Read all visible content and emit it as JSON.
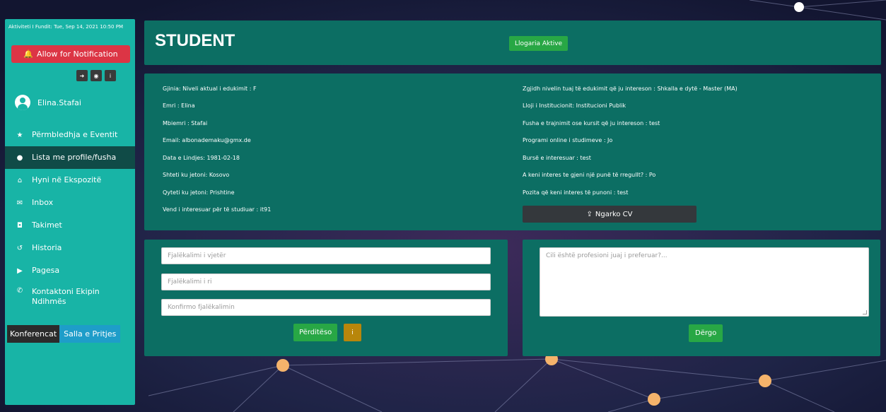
{
  "sidebar": {
    "last_activity": "Aktiviteti I Fundit: Tue, Sep 14, 2021 10:50 PM",
    "notification_label": "Allow for Notification",
    "tools": [
      {
        "icon": "logout-icon",
        "glyph": "➜"
      },
      {
        "icon": "globe-icon",
        "glyph": "◉"
      },
      {
        "icon": "info-icon",
        "glyph": "i"
      }
    ],
    "username": "Elina.Stafai",
    "items": [
      {
        "label": "Përmbledhja e Eventit",
        "icon": "star-icon",
        "glyph": "★",
        "active": false
      },
      {
        "label": "Lista me profile/fusha",
        "icon": "user-icon",
        "glyph": "●",
        "active": true
      },
      {
        "label": "Hyni në Ekspozitë",
        "icon": "bank-icon",
        "glyph": "⌂",
        "active": false
      },
      {
        "label": "Inbox",
        "icon": "envelope-icon",
        "glyph": "✉",
        "active": false
      },
      {
        "label": "Takimet",
        "icon": "camera-icon",
        "glyph": "◘",
        "active": false
      },
      {
        "label": "Historia",
        "icon": "history-icon",
        "glyph": "↺",
        "active": false
      },
      {
        "label": "Pagesa",
        "icon": "payment-icon",
        "glyph": "▶",
        "active": false
      },
      {
        "label": "Kontaktoni Ekipin Ndihmës",
        "icon": "phone-icon",
        "glyph": "✆",
        "active": false
      }
    ],
    "tab_conferences": "Konferencat",
    "tab_waiting_room": "Salla e Pritjes"
  },
  "header": {
    "title": "STUDENT",
    "status": "Llogaria Aktive"
  },
  "profile": {
    "left_fields": [
      "Gjinia: Niveli aktual i edukimit : F",
      "Emri : Elina",
      "Mbiemri : Stafai",
      "Email: albonademaku@gmx.de",
      "Data e Lindjes: 1981-02-18",
      "Shteti ku jetoni: Kosovo",
      "Qyteti ku jetoni: Prishtine",
      "Vend i interesuar për të studiuar : it91"
    ],
    "right_fields": [
      "Zgjidh nivelin tuaj të edukimit që ju intereson : Shkalla e dytë - Master (MA)",
      "Lloji i Institucionit: Institucioni Publik",
      "Fusha e trajnimit ose kursit që ju intereson : test",
      "Programi online i studimeve : Jo",
      "Bursë e interesuar : test",
      "A keni interes te gjeni një punë të rregullt? : Po",
      "Pozita që keni interes të punoni : test"
    ],
    "upload_cv_label": "Ngarko CV"
  },
  "password_form": {
    "old_placeholder": "Fjalëkalimi i vjetër",
    "new_placeholder": "Fjalëkalimi i ri",
    "confirm_placeholder": "Konfirmo fjalëkalimin",
    "update_label": "Përditëso"
  },
  "profession_form": {
    "placeholder": "Cili është profesioni juaj i preferuar?...",
    "send_label": "Dërgo"
  },
  "colors": {
    "sidebar": "#18b4a6",
    "panel": "#0c6e63",
    "active_nav": "#104b47",
    "danger": "#dc3545",
    "success": "#28a745",
    "warning": "#b8860b"
  }
}
